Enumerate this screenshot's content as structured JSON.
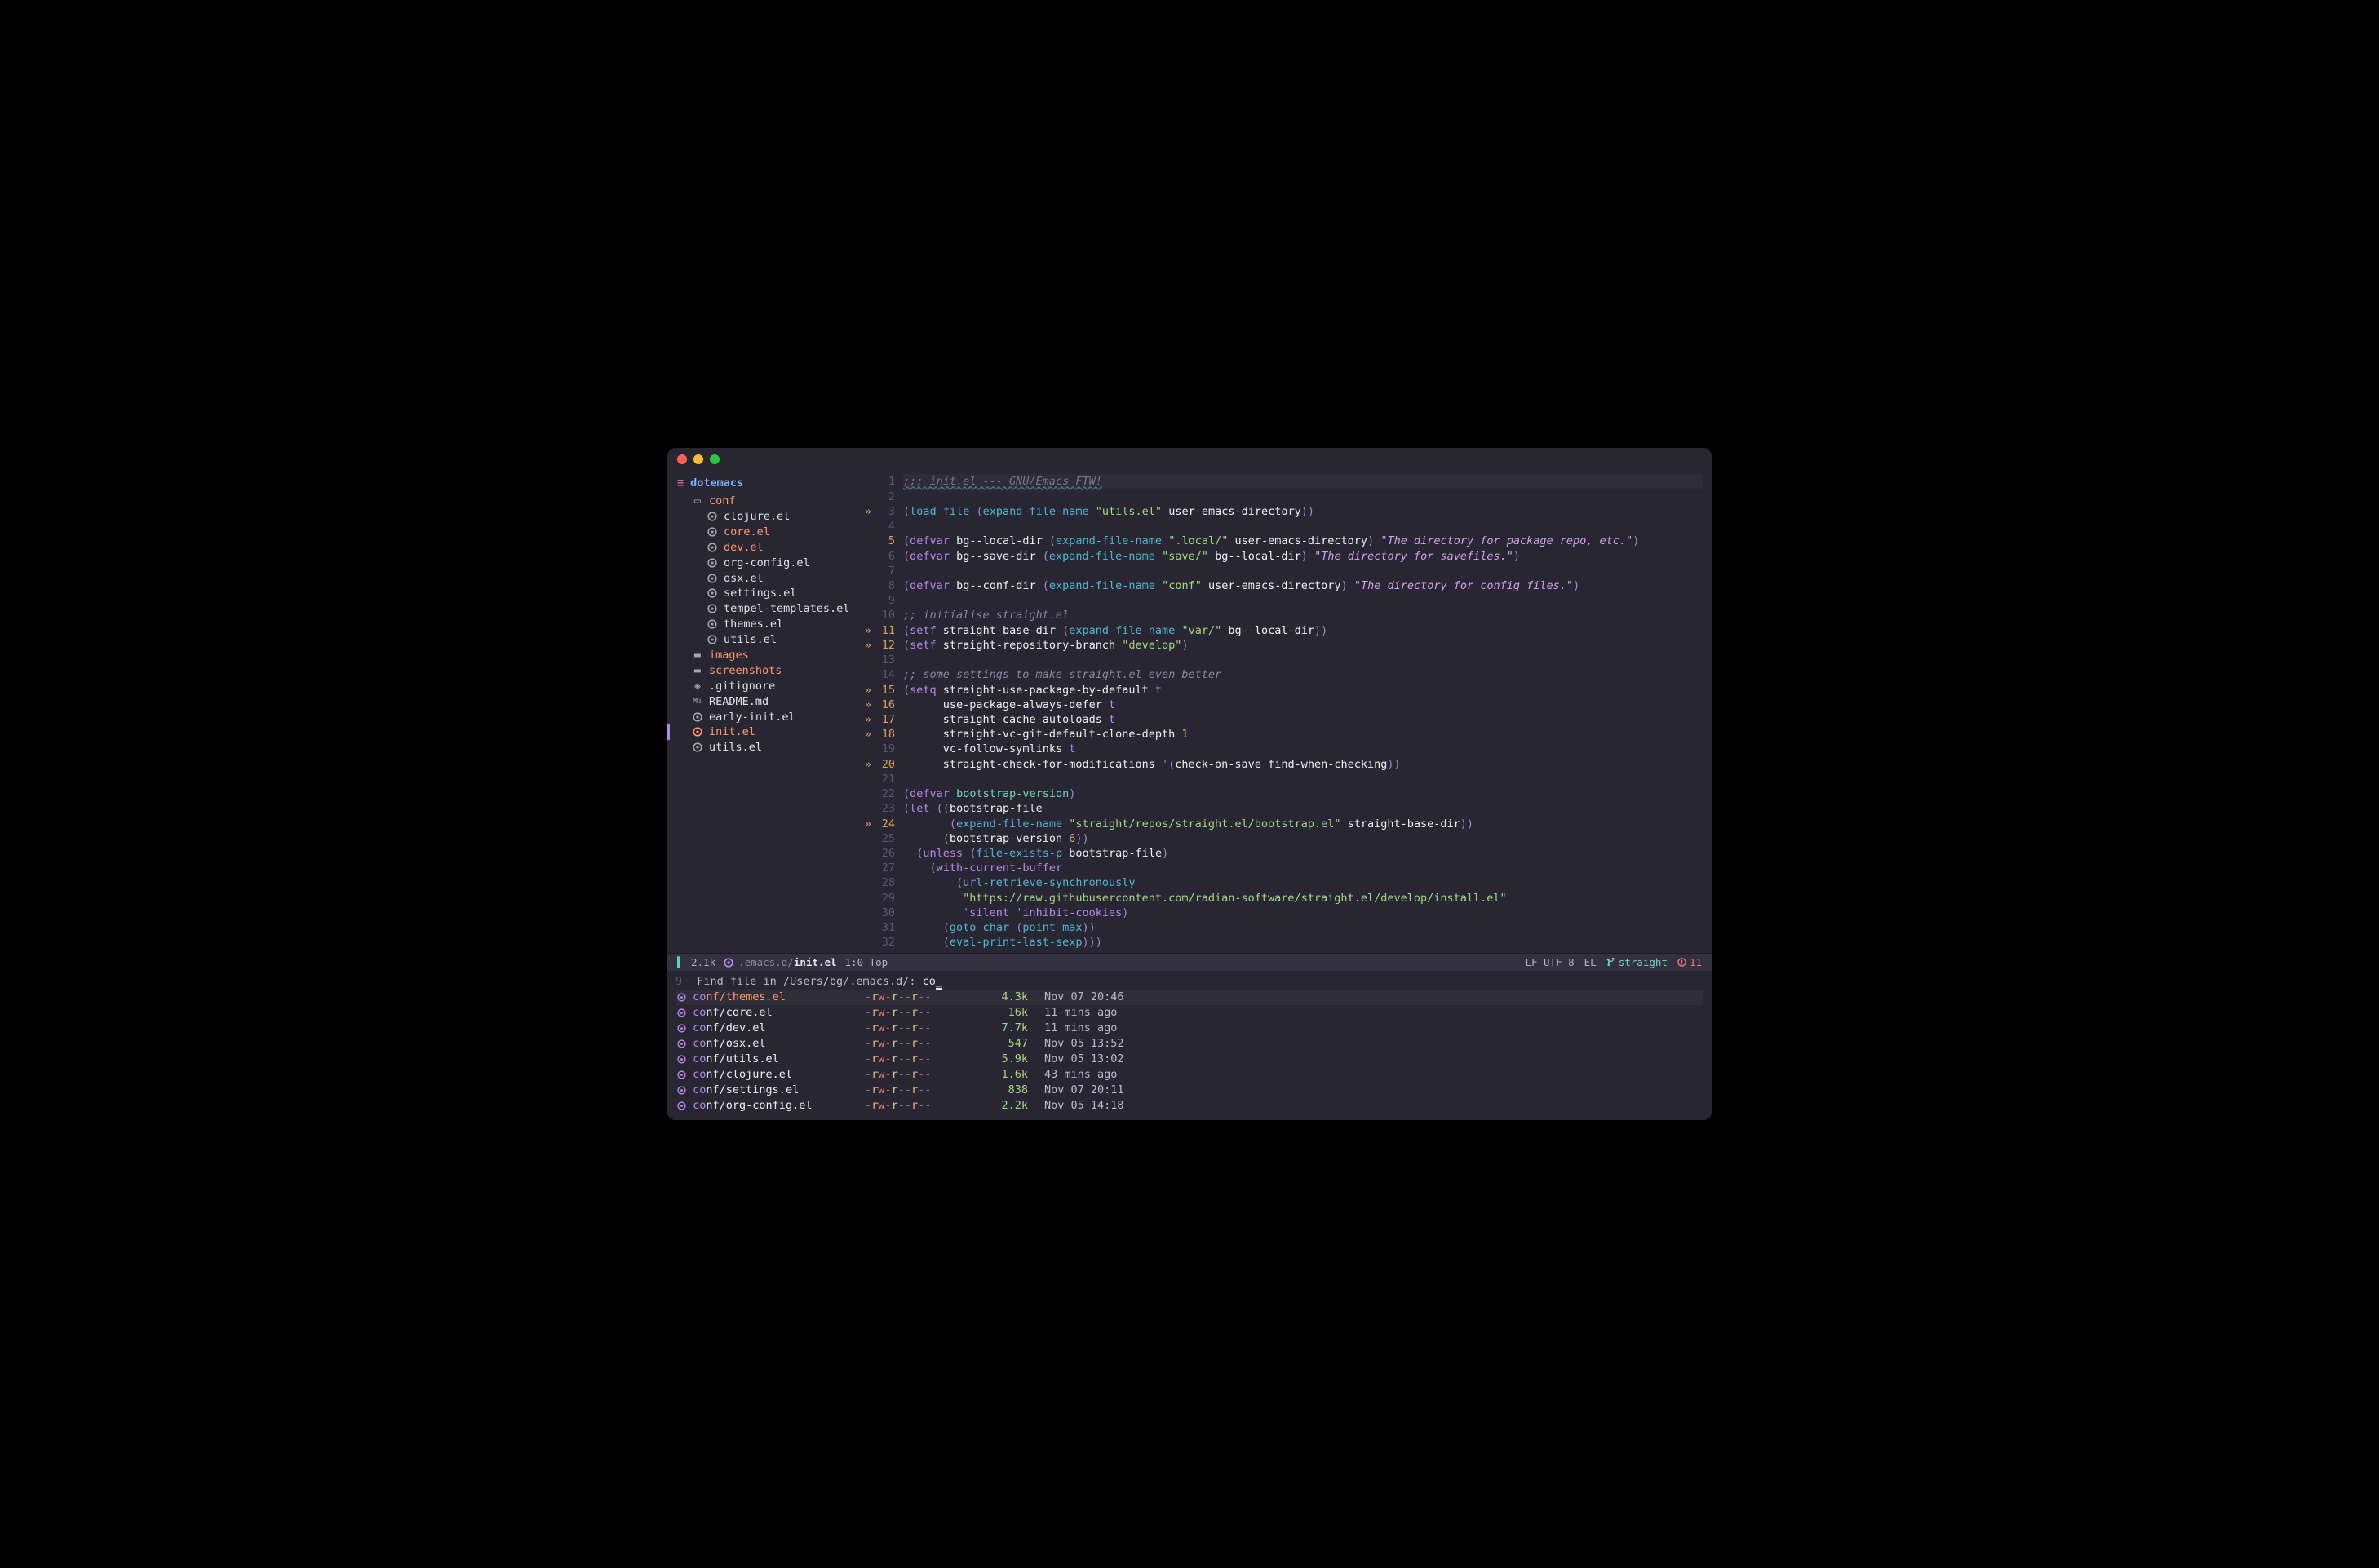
{
  "window": {
    "traffic": [
      "close",
      "min",
      "max"
    ]
  },
  "project": {
    "name": "dotemacs"
  },
  "sidebar": {
    "items": [
      {
        "icon": "folder-open",
        "label": "conf",
        "cls": "folder",
        "ind": 1
      },
      {
        "icon": "lisp",
        "label": "clojure.el",
        "cls": "file-default",
        "ind": 2
      },
      {
        "icon": "lisp",
        "label": "core.el",
        "cls": "file-core",
        "ind": 2
      },
      {
        "icon": "lisp",
        "label": "dev.el",
        "cls": "file-dev",
        "ind": 2
      },
      {
        "icon": "lisp",
        "label": "org-config.el",
        "cls": "file-default",
        "ind": 2
      },
      {
        "icon": "lisp",
        "label": "osx.el",
        "cls": "file-default",
        "ind": 2
      },
      {
        "icon": "lisp",
        "label": "settings.el",
        "cls": "file-default",
        "ind": 2
      },
      {
        "icon": "lisp",
        "label": "tempel-templates.el",
        "cls": "file-default",
        "ind": 2
      },
      {
        "icon": "lisp",
        "label": "themes.el",
        "cls": "file-default",
        "ind": 2
      },
      {
        "icon": "lisp",
        "label": "utils.el",
        "cls": "file-default",
        "ind": 2
      },
      {
        "icon": "folder",
        "label": "images",
        "cls": "folder",
        "ind": 1
      },
      {
        "icon": "folder",
        "label": "screenshots",
        "cls": "folder",
        "ind": 1
      },
      {
        "icon": "git",
        "label": ".gitignore",
        "cls": "file-default",
        "ind": 1
      },
      {
        "icon": "md",
        "label": "README.md",
        "cls": "file-default",
        "ind": 1
      },
      {
        "icon": "lisp",
        "label": "early-init.el",
        "cls": "file-default",
        "ind": 1
      },
      {
        "icon": "lisp-active",
        "label": "init.el",
        "cls": "file-active",
        "ind": 1,
        "active": true
      },
      {
        "icon": "lisp",
        "label": "utils.el",
        "cls": "file-default",
        "ind": 1
      }
    ]
  },
  "code": {
    "lines": [
      {
        "n": 1,
        "mark": " ",
        "html": "<span class='cmt wavy'>;;; init.el --- GNU/Emacs FTW!</span>",
        "hl": true
      },
      {
        "n": 2,
        "mark": " ",
        "html": ""
      },
      {
        "n": 3,
        "mark": "»",
        "html": "<span class='par'>(</span><span class='fn ul'>load-file</span> <span class='par'>(</span><span class='fn ul'>expand-file-name</span> <span class='str ul'>\"utils.el\"</span> <span class='varname ul'>user-emacs-directory</span><span class='par'>))</span>"
      },
      {
        "n": 4,
        "mark": " ",
        "html": ""
      },
      {
        "n": 5,
        "mark": " ",
        "html": "<span class='par'>(</span><span class='kw'>defvar</span> <span class='varname'>bg--local-dir</span> <span class='par'>(</span><span class='fn'>expand-file-name</span> <span class='str'>\".local/\"</span> <span class='varname'>user-emacs-directory</span><span class='par'>)</span> <span class='doc'>\"The directory for package repo, etc.\"</span><span class='par'>)</span>"
      },
      {
        "n": 6,
        "mark": " ",
        "html": "<span class='par'>(</span><span class='kw'>defvar</span> <span class='varname'>bg--save-dir</span> <span class='par'>(</span><span class='fn'>expand-file-name</span> <span class='str'>\"save/\"</span> <span class='varname'>bg--local-dir</span><span class='par'>)</span> <span class='doc'>\"The directory for savefiles.\"</span><span class='par'>)</span>"
      },
      {
        "n": 7,
        "mark": " ",
        "html": ""
      },
      {
        "n": 8,
        "mark": " ",
        "html": "<span class='par'>(</span><span class='kw'>defvar</span> <span class='varname'>bg--conf-dir</span> <span class='par'>(</span><span class='fn'>expand-file-name</span> <span class='str'>\"conf\"</span> <span class='varname'>user-emacs-directory</span><span class='par'>)</span> <span class='doc'>\"The directory for config files.\"</span><span class='par'>)</span>"
      },
      {
        "n": 9,
        "mark": " ",
        "html": ""
      },
      {
        "n": 10,
        "mark": " ",
        "html": "<span class='cmt2'>;; initialise straight.el</span>"
      },
      {
        "n": 11,
        "mark": "»",
        "html": "<span class='par'>(</span><span class='kw'>setf</span> <span class='varname'>straight-base-dir</span> <span class='par'>(</span><span class='fn'>expand-file-name</span> <span class='str'>\"var/\"</span> <span class='varname'>bg--local-dir</span><span class='par'>))</span>"
      },
      {
        "n": 12,
        "mark": "»",
        "html": "<span class='par'>(</span><span class='kw'>setf</span> <span class='varname'>straight-repository-branch</span> <span class='str'>\"develop\"</span><span class='par'>)</span>"
      },
      {
        "n": 13,
        "mark": " ",
        "html": ""
      },
      {
        "n": 14,
        "mark": " ",
        "html": "<span class='cmt2'>;; some settings to make straight.el even better</span>"
      },
      {
        "n": 15,
        "mark": "»",
        "html": "<span class='par'>(</span><span class='kw'>setq</span> <span class='varname'>straight-use-package-by-default</span> <span class='t'>t</span>"
      },
      {
        "n": 16,
        "mark": "»",
        "html": "      <span class='varname'>use-package-always-defer</span> <span class='t'>t</span>"
      },
      {
        "n": 17,
        "mark": "»",
        "html": "      <span class='varname'>straight-cache-autoloads</span> <span class='t'>t</span>"
      },
      {
        "n": 18,
        "mark": "»",
        "html": "      <span class='varname'>straight-vc-git-default-clone-depth</span> <span class='num'>1</span>"
      },
      {
        "n": 19,
        "mark": " ",
        "html": "      <span class='varname'>vc-follow-symlinks</span> <span class='t'>t</span>"
      },
      {
        "n": 20,
        "mark": "»",
        "html": "      <span class='varname'>straight-check-for-modifications</span> <span class='par'>'(</span><span class='varname'>check-on-save find-when-checking</span><span class='par'>))</span>"
      },
      {
        "n": 21,
        "mark": " ",
        "html": ""
      },
      {
        "n": 22,
        "mark": " ",
        "html": "<span class='par'>(</span><span class='kw'>defvar</span> <span class='varname' style='color:#6fd6be'>bootstrap-version</span><span class='par'>)</span>"
      },
      {
        "n": 23,
        "mark": " ",
        "html": "<span class='par'>(</span><span class='kw'>let</span> <span class='par'>((</span><span class='varname'>bootstrap-file</span>"
      },
      {
        "n": 24,
        "mark": "»",
        "html": "       <span class='par'>(</span><span class='fn'>expand-file-name</span> <span class='str'>\"straight/repos/straight.el/bootstrap.el\"</span> <span class='varname'>straight-base-dir</span><span class='par'>))</span>"
      },
      {
        "n": 25,
        "mark": " ",
        "html": "      <span class='par'>(</span><span class='varname'>bootstrap-version</span> <span class='num'>6</span><span class='par'>))</span>"
      },
      {
        "n": 26,
        "mark": " ",
        "html": "  <span class='par'>(</span><span class='kw'>unless</span> <span class='par'>(</span><span class='fn'>file-exists-p</span> <span class='varname'>bootstrap-file</span><span class='par'>)</span>"
      },
      {
        "n": 27,
        "mark": " ",
        "html": "    <span class='par'>(</span><span class='kw'>with-current-buffer</span>"
      },
      {
        "n": 28,
        "mark": " ",
        "html": "        <span class='par'>(</span><span class='fn'>url-retrieve-synchronously</span>"
      },
      {
        "n": 29,
        "mark": " ",
        "html": "         <span class='str'>\"https://raw.githubusercontent.com/radian-software/straight.el/develop/install.el\"</span>"
      },
      {
        "n": 30,
        "mark": " ",
        "html": "         <span class='t'>'silent</span> <span class='t'>'inhibit-cookies</span><span class='par'>)</span>"
      },
      {
        "n": 31,
        "mark": " ",
        "html": "      <span class='par'>(</span><span class='fn'>goto-char</span> <span class='par'>(</span><span class='fn'>point-max</span><span class='par'>))</span>"
      },
      {
        "n": 32,
        "mark": " ",
        "html": "      <span class='par'>(</span><span class='fn'>eval-print-last-sexp</span><span class='par'>)))</span>"
      }
    ],
    "orange_lines": [
      5,
      11,
      12,
      15,
      16,
      17,
      18,
      20,
      24
    ]
  },
  "modeline": {
    "size": "2.1k",
    "path_dir": ".emacs.d/",
    "path_file": "init.el",
    "pos": "1:0 Top",
    "encoding": "LF UTF-8",
    "mode": "EL",
    "branch": "straight",
    "errors": "11"
  },
  "minibuffer": {
    "count": "9",
    "prompt": "Find file in ",
    "path": "/Users/bg/.emacs.d/",
    "sep": ": ",
    "input": "co",
    "cursor": "_",
    "candidates": [
      {
        "match": "co",
        "rest": "nf/themes.el",
        "perm": "-rw-r--r--",
        "size": "4.3k",
        "date": "Nov 07 20:46",
        "sel": true
      },
      {
        "match": "co",
        "rest": "nf/core.el",
        "perm": "-rw-r--r--",
        "size": "16k",
        "date": "11 mins ago"
      },
      {
        "match": "co",
        "rest": "nf/dev.el",
        "perm": "-rw-r--r--",
        "size": "7.7k",
        "date": "11 mins ago"
      },
      {
        "match": "co",
        "rest": "nf/osx.el",
        "perm": "-rw-r--r--",
        "size": "547",
        "date": "Nov 05 13:52"
      },
      {
        "match": "co",
        "rest": "nf/utils.el",
        "perm": "-rw-r--r--",
        "size": "5.9k",
        "date": "Nov 05 13:02"
      },
      {
        "match": "co",
        "rest": "nf/clojure.el",
        "perm": "-rw-r--r--",
        "size": "1.6k",
        "date": "43 mins ago"
      },
      {
        "match": "co",
        "rest": "nf/settings.el",
        "perm": "-rw-r--r--",
        "size": "838",
        "date": "Nov 07 20:11"
      },
      {
        "match": "co",
        "rest": "nf/org-config.el",
        "perm": "-rw-r--r--",
        "size": "2.2k",
        "date": "Nov 05 14:18"
      }
    ]
  },
  "icons": {
    "hamburger": "≡",
    "folder_open": "▢",
    "folder": "■",
    "lisp": "⊛",
    "git": "◆",
    "md": "M↓"
  }
}
